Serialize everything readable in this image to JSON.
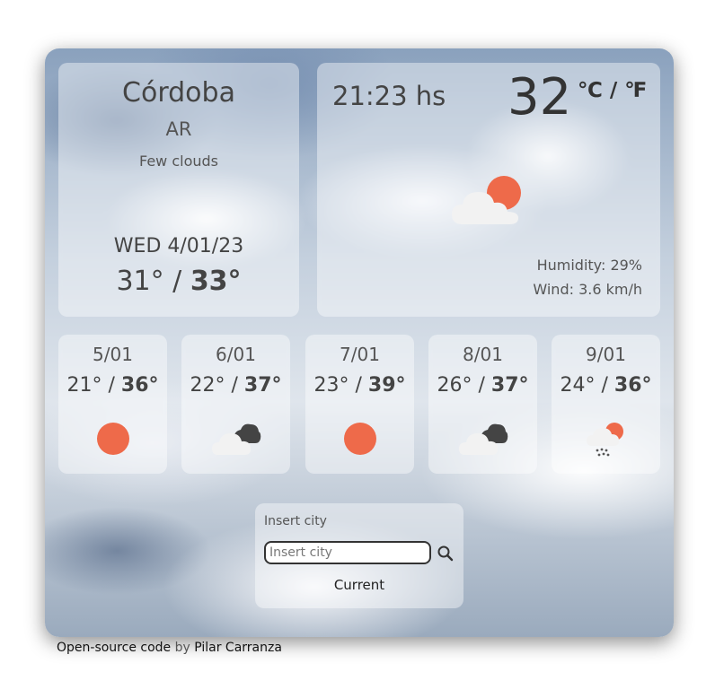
{
  "current": {
    "city": "Córdoba",
    "country": "AR",
    "description": "Few clouds",
    "date": "WED 4/01/23",
    "min": "31°",
    "separator": " / ",
    "max": "33°",
    "time": "21:23 hs",
    "temperature": "32",
    "units": "℃ / ℉",
    "humidity": "Humidity: 29%",
    "wind": "Wind: 3.6 km/h",
    "icon": "sun-behind-cloud-icon"
  },
  "forecast": [
    {
      "date": "5/01",
      "min": "21°",
      "max": "36°",
      "icon": "sun-icon"
    },
    {
      "date": "6/01",
      "min": "22°",
      "max": "37°",
      "icon": "dark-cloud-icon"
    },
    {
      "date": "7/01",
      "min": "23°",
      "max": "39°",
      "icon": "sun-icon"
    },
    {
      "date": "8/01",
      "min": "26°",
      "max": "37°",
      "icon": "dark-cloud-icon"
    },
    {
      "date": "9/01",
      "min": "24°",
      "max": "36°",
      "icon": "sun-rain-cloud-icon"
    }
  ],
  "search": {
    "label": "Insert city",
    "placeholder": "Insert city",
    "current_label": "Current",
    "icon": "search-icon"
  },
  "footer": {
    "link_text": "Open-source code",
    "by": " by ",
    "author": "Pilar Carranza"
  },
  "colors": {
    "sun": "#ee6a4a",
    "cloud": "#f2f2f2",
    "dark_cloud": "#444444"
  }
}
